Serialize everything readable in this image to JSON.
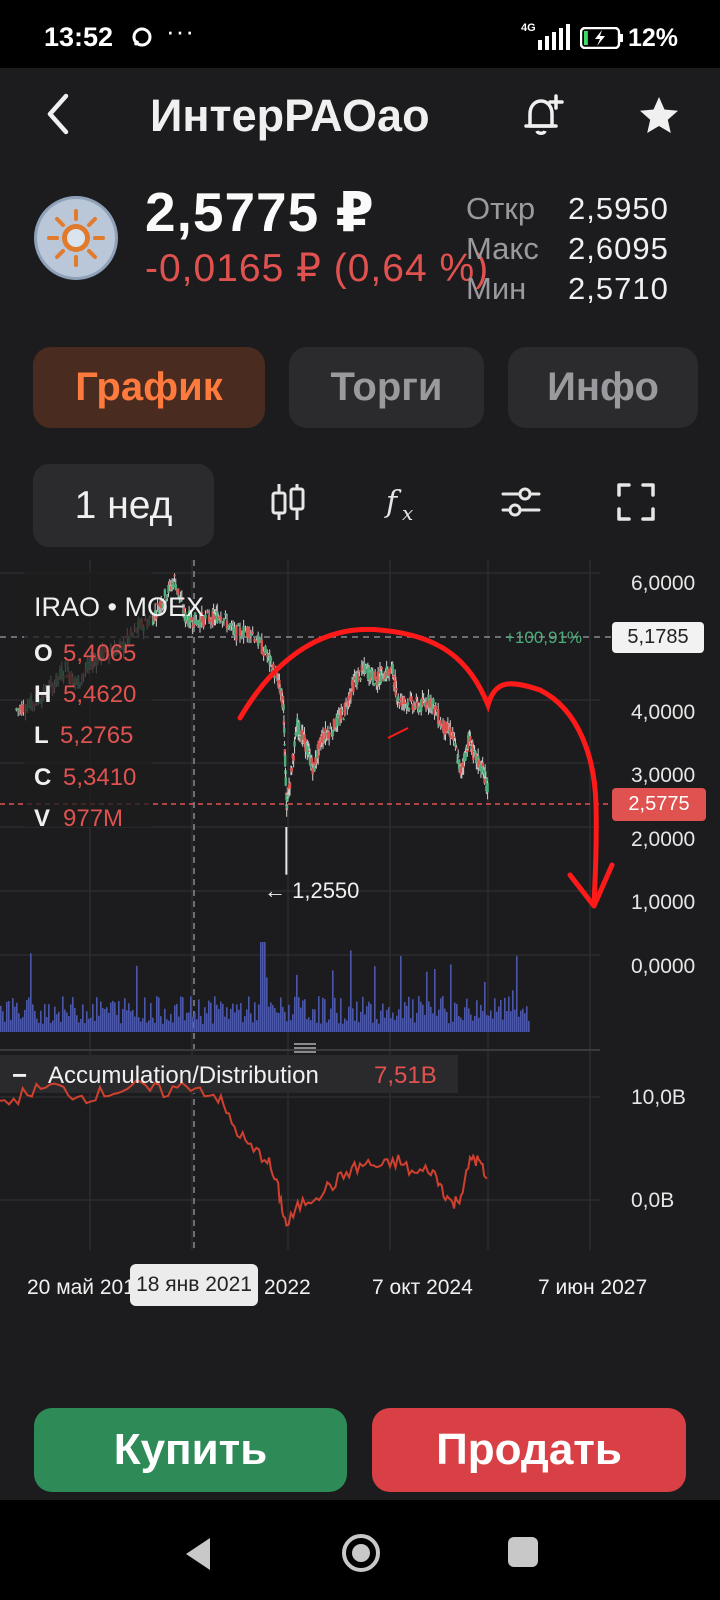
{
  "status_bar": {
    "time": "13:52",
    "dots": "···",
    "network": "4G",
    "battery_pct": "12%",
    "battery_level": 0.12
  },
  "header": {
    "title": "ИнтерРАОао",
    "back_icon": "chevron-left-icon",
    "bell_icon": "bell-plus-icon",
    "star_icon": "star-icon"
  },
  "quote": {
    "price": "2,5775 ₽",
    "change": "-0,0165 ₽ (0,64 %)",
    "open_label": "Откр",
    "open_value": "2,5950",
    "high_label": "Макс",
    "high_value": "2,6095",
    "low_label": "Мин",
    "low_value": "2,5710"
  },
  "tabs": [
    {
      "label": "График",
      "active": true
    },
    {
      "label": "Торги",
      "active": false
    },
    {
      "label": "Инфо",
      "active": false
    }
  ],
  "toolbar": {
    "period": "1 нед",
    "icons": [
      "candles-icon",
      "function-icon",
      "sliders-icon",
      "fullscreen-icon"
    ]
  },
  "chart_data": {
    "type": "candlestick",
    "ticker": "IRAO • MOEX",
    "ohlcv": {
      "O": "5,4065",
      "H": "5,4620",
      "L": "5,2765",
      "C": "5,3410",
      "V": "977M"
    },
    "y_ticks": [
      "6,0000",
      "4,0000",
      "3,0000",
      "2,0000",
      "1,0000",
      "0,0000"
    ],
    "ylim": [
      0,
      6
    ],
    "crosshair_price": "5,1785",
    "crosshair_pct": "+100,91%",
    "last_price": "2,5775",
    "min_marker": "← 1,2550",
    "x_labels": [
      "20 май 201",
      "2022",
      "7 окт 2024",
      "7 июн 2027"
    ],
    "x_cursor": "18 янв 2021",
    "x_years": [
      2017,
      2028
    ],
    "price_series": [
      [
        2017.3,
        3.85
      ],
      [
        2017.6,
        3.95
      ],
      [
        2017.9,
        4.15
      ],
      [
        2018.2,
        4.5
      ],
      [
        2018.4,
        4.25
      ],
      [
        2018.7,
        4.6
      ],
      [
        2018.9,
        4.75
      ],
      [
        2019.2,
        4.8
      ],
      [
        2019.5,
        5.1
      ],
      [
        2019.8,
        5.3
      ],
      [
        2020.0,
        5.6
      ],
      [
        2020.2,
        5.9
      ],
      [
        2020.4,
        5.3
      ],
      [
        2020.6,
        5.25
      ],
      [
        2020.9,
        5.3
      ],
      [
        2021.05,
        5.35
      ],
      [
        2021.3,
        5.05
      ],
      [
        2021.6,
        5.1
      ],
      [
        2021.9,
        4.7
      ],
      [
        2022.1,
        4.3
      ],
      [
        2022.2,
        3.9
      ],
      [
        2022.25,
        2.3
      ],
      [
        2022.3,
        2.6
      ],
      [
        2022.45,
        3.6
      ],
      [
        2022.6,
        3.3
      ],
      [
        2022.75,
        2.9
      ],
      [
        2022.9,
        3.4
      ],
      [
        2023.1,
        3.55
      ],
      [
        2023.3,
        3.8
      ],
      [
        2023.5,
        4.3
      ],
      [
        2023.7,
        4.5
      ],
      [
        2023.9,
        4.3
      ],
      [
        2024.0,
        4.4
      ],
      [
        2024.2,
        4.45
      ],
      [
        2024.3,
        4.0
      ],
      [
        2024.5,
        3.95
      ],
      [
        2024.7,
        3.9
      ],
      [
        2024.9,
        4.0
      ],
      [
        2025.1,
        3.6
      ],
      [
        2025.3,
        3.45
      ],
      [
        2025.45,
        2.85
      ],
      [
        2025.6,
        3.4
      ],
      [
        2025.7,
        3.1
      ],
      [
        2025.85,
        2.9
      ],
      [
        2025.95,
        2.58
      ]
    ],
    "indicator": {
      "name": "Accumulation/Distribution",
      "value": "7,51B",
      "ticks": [
        "10,0B",
        "0,0B"
      ]
    }
  },
  "actions": {
    "buy": "Купить",
    "sell": "Продать"
  },
  "colors": {
    "accent": "#ff7a3d",
    "up": "#4caf7a",
    "down": "#e0524f",
    "buy": "#2e8b57",
    "sell": "#d94045",
    "annotation": "#ff1a1a"
  }
}
